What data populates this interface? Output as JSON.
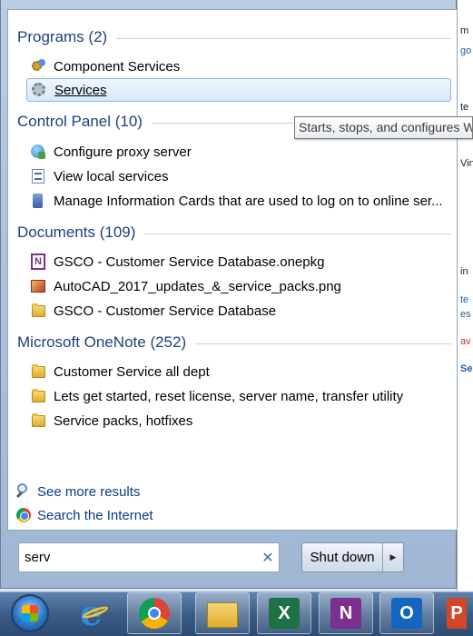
{
  "background_window": {
    "fragments": [
      "m",
      "go",
      "te",
      "Vin",
      "in",
      "te",
      "es",
      "av",
      "Se"
    ]
  },
  "groups": {
    "programs": {
      "title": "Programs (2)",
      "items": [
        {
          "label": "Component Services",
          "icon": "component-services-icon"
        },
        {
          "label": "Services",
          "icon": "services-gear-icon"
        }
      ]
    },
    "control_panel": {
      "title": "Control Panel (10)",
      "items": [
        {
          "label": "Configure proxy server",
          "icon": "globe-icon"
        },
        {
          "label": "View local services",
          "icon": "services-list-icon"
        },
        {
          "label": "Manage Information Cards that are used to log on to online ser...",
          "icon": "information-card-icon"
        }
      ]
    },
    "documents": {
      "title": "Documents (109)",
      "items": [
        {
          "label": "GSCO - Customer Service Database.onepkg",
          "icon": "onenote-file-icon"
        },
        {
          "label": "AutoCAD_2017_updates_&_service_packs.png",
          "icon": "image-file-icon"
        },
        {
          "label": "GSCO - Customer Service Database",
          "icon": "folder-icon"
        }
      ]
    },
    "onenote": {
      "title": "Microsoft OneNote (252)",
      "items": [
        {
          "label": "Customer Service all dept",
          "icon": "folder-icon"
        },
        {
          "label": "Lets get started, reset license, server name, transfer utility",
          "icon": "folder-icon"
        },
        {
          "label": "Service packs, hotfixes",
          "icon": "folder-icon"
        }
      ]
    }
  },
  "links": {
    "see_more": "See more results",
    "search_internet": "Search the Internet"
  },
  "search": {
    "value": "serv",
    "clear_icon": "✕"
  },
  "shutdown": {
    "label": "Shut down",
    "arrow": "▶"
  },
  "tooltip": {
    "text": "Starts, stops, and configures W"
  },
  "taskbar": {
    "apps": [
      "start-orb",
      "internet-explorer",
      "chrome",
      "file-explorer",
      "excel",
      "onenote",
      "outlook",
      "powerpoint"
    ],
    "excel_glyph": "X",
    "onenote_glyph": "N",
    "outlook_glyph": "O",
    "ppt_glyph": "P"
  }
}
